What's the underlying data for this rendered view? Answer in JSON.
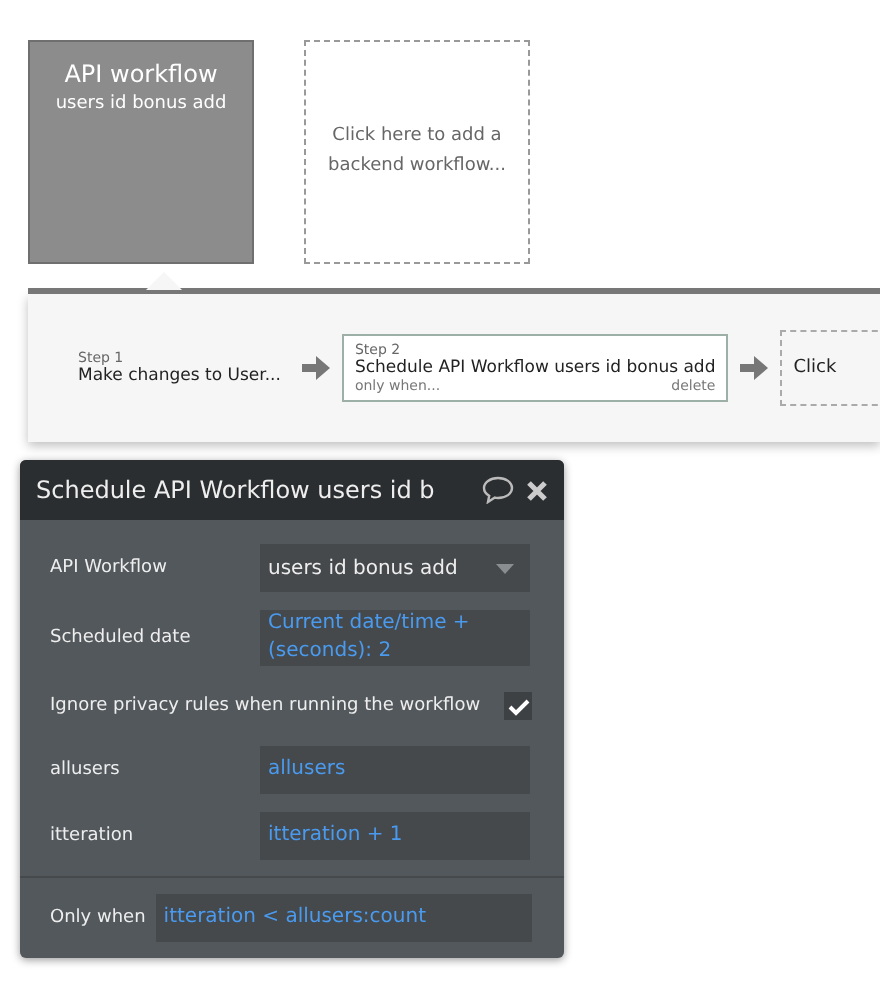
{
  "workflows": [
    {
      "kind": "card",
      "title": "API workflow",
      "subtitle": "users id bonus add"
    },
    {
      "kind": "add",
      "text": "Click here to add a backend workflow..."
    }
  ],
  "steps": [
    {
      "kind": "step",
      "step": "Step 1",
      "title": "Make changes to User...",
      "selected": false
    },
    {
      "kind": "step",
      "step": "Step 2",
      "title": "Schedule API Workflow users id bonus add",
      "condition": "only when...",
      "delete": "delete",
      "selected": true
    },
    {
      "kind": "add",
      "text": "Click"
    }
  ],
  "editor": {
    "title": "Schedule API Workflow users id b",
    "rows": [
      {
        "kind": "dropdown",
        "label": "API Workflow",
        "value": "users id bonus add"
      },
      {
        "kind": "expression",
        "label": "Scheduled date",
        "value": "Current date/time + (seconds): 2"
      },
      {
        "kind": "checkbox",
        "label": "Ignore privacy rules when running the workflow",
        "checked": true
      },
      {
        "kind": "expression",
        "label": "allusers",
        "value": "allusers"
      },
      {
        "kind": "expression",
        "label": "itteration",
        "value": "itteration + 1"
      }
    ],
    "only_when": {
      "label": "Only when",
      "value": "itteration < allusers:count"
    }
  }
}
